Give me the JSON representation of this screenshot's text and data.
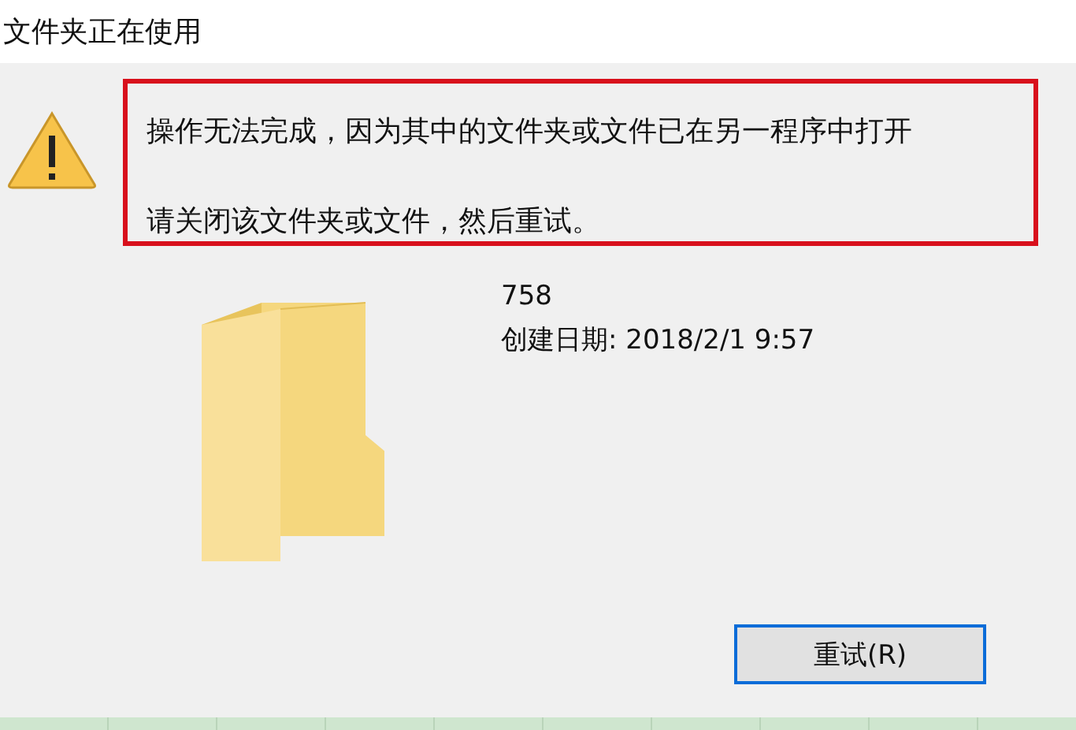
{
  "window": {
    "title": "文件夹正在使用"
  },
  "message": {
    "lines": [
      "操作无法完成，因为其中的文件夹或文件已在另一程序中打开",
      "请关闭该文件夹或文件，然后重试。"
    ],
    "highlighted": true
  },
  "item": {
    "name": "758",
    "details": "创建日期: 2018/2/1 9:57"
  },
  "buttons": [
    {
      "label": "重试(R)",
      "selected": true
    }
  ]
}
